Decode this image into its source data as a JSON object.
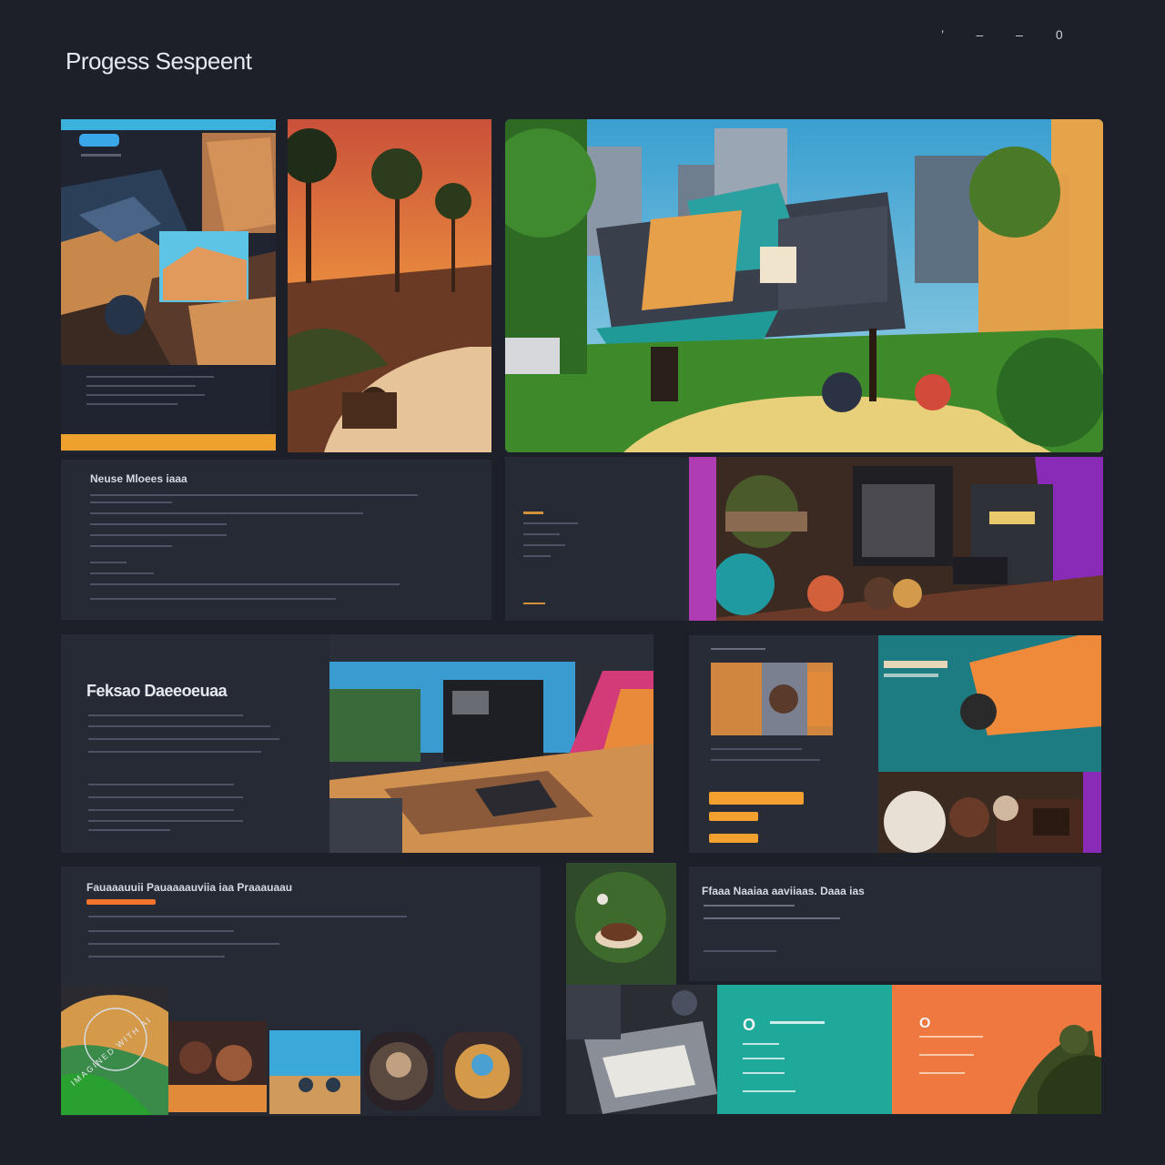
{
  "header": {
    "title": "Progess Sespeent",
    "status_right": "’ – – 0"
  },
  "panels": {
    "top_left_card": {
      "button_label": "",
      "lines": [
        "",
        "",
        ""
      ]
    },
    "text_block_1": {
      "heading": "Neuse Mloees iaaa",
      "lines": [
        "— — — — —",
        "— — — —",
        "— — —",
        "— —",
        "—",
        "— — — —",
        "— — —"
      ]
    },
    "feature_block": {
      "heading": "Feksao Daeeoeuaa",
      "lines": [
        "— — —",
        "— —",
        "— — —",
        "—",
        "— —",
        "— — —",
        "—"
      ]
    },
    "bottom_left_block": {
      "heading": "Fauaaauuii Pauaaaauviia iaa Praaauaau",
      "lines": [
        "— — — —",
        "— — —",
        "— —"
      ]
    },
    "bottom_right_block": {
      "heading": "Ffaaa Naaiaa aaviiaas. Daaa ias",
      "lines": [
        "— —",
        "— — —"
      ]
    },
    "teal_card": {
      "label": "O"
    },
    "orange_card": {
      "label": "O"
    }
  },
  "watermark": {
    "text": "IMAGINED WITH AI"
  },
  "colors": {
    "background": "#1d2029",
    "panel": "#252a35",
    "accent_orange": "#f2a030",
    "accent_blue": "#39b6e0",
    "accent_teal": "#1fa99a",
    "accent_purple": "#8a2bb8",
    "accent_coral": "#ee7840"
  }
}
